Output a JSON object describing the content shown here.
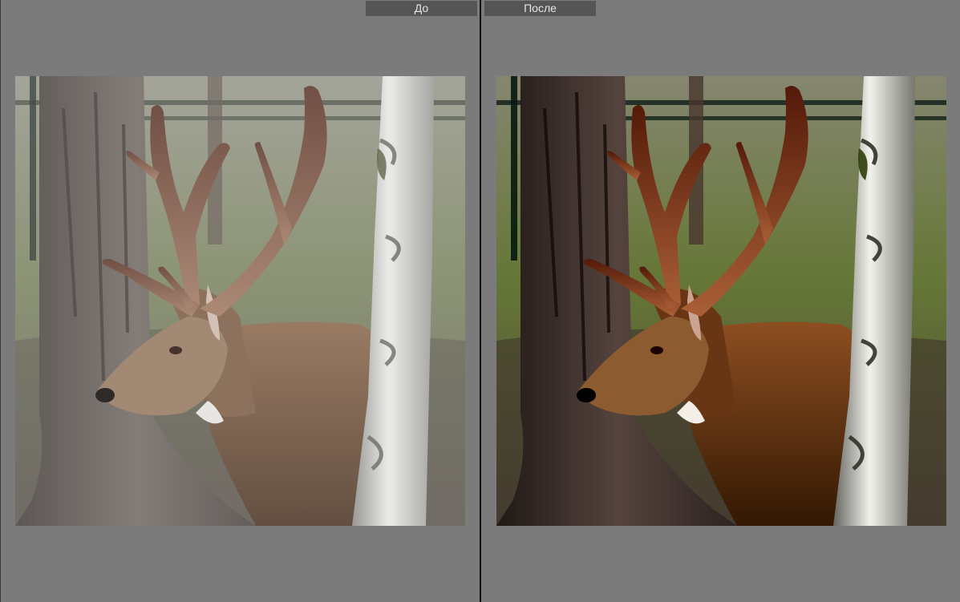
{
  "compare": {
    "before_label": "До",
    "after_label": "После"
  },
  "colors": {
    "background": "#7b7b7b",
    "tab_background": "#555555",
    "tab_text": "#e6e6e6",
    "divider": "#111111"
  }
}
